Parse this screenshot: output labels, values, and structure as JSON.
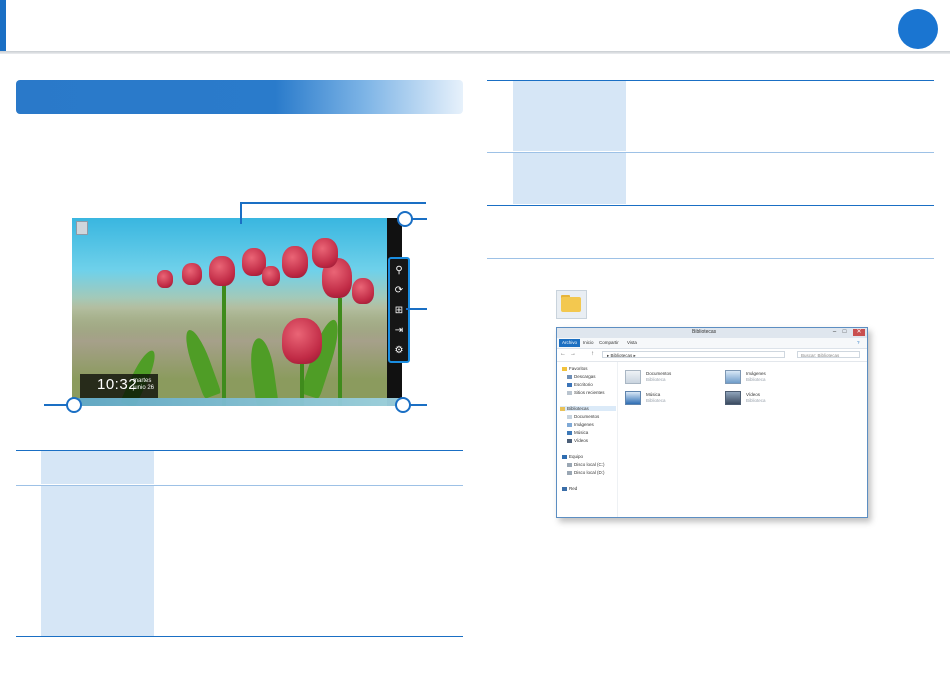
{
  "colors": {
    "accent": "#1a6fc4",
    "header_dot": "#1a75d1",
    "table_cell": "#d6e6f6",
    "charm_border": "#1a8de0"
  },
  "lock_clock": {
    "time": "10:32",
    "day": "martes",
    "date": "junio 26"
  },
  "explorer": {
    "title": "Bibliotecas",
    "ribbon_tabs": [
      "Archivo",
      "Inicio",
      "Compartir",
      "Vista"
    ],
    "address": "Bibliotecas",
    "search_placeholder": "Buscar: Bibliotecas",
    "nav": {
      "favorites": {
        "label": "Favoritos",
        "items": [
          "Descargas",
          "Escritorio",
          "Sitios recientes"
        ]
      },
      "libraries": {
        "label": "Bibliotecas",
        "items": [
          "Documentos",
          "Imágenes",
          "Música",
          "Vídeos"
        ]
      },
      "computer": {
        "label": "Equipo",
        "items": [
          "Disco local (C:)",
          "Disco local (D:)"
        ]
      },
      "network": "Red"
    },
    "content": [
      {
        "name": "Documentos",
        "type": "Biblioteca",
        "icon": "documents-library-icon"
      },
      {
        "name": "Imágenes",
        "type": "Biblioteca",
        "icon": "pictures-library-icon"
      },
      {
        "name": "Música",
        "type": "Biblioteca",
        "icon": "music-library-icon"
      },
      {
        "name": "Vídeos",
        "type": "Biblioteca",
        "icon": "videos-library-icon"
      }
    ]
  },
  "icons": {
    "charm_search": "search-icon",
    "charm_share": "share-icon",
    "charm_start": "windows-start-icon",
    "charm_devices": "devices-icon",
    "charm_settings": "gear-icon",
    "library_shortcut": "libraries-folder-icon"
  }
}
